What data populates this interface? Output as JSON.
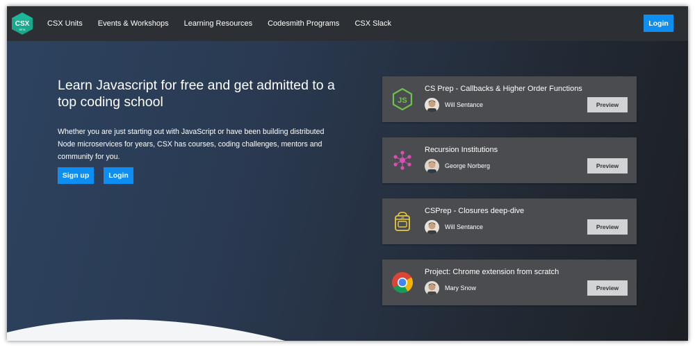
{
  "brand": {
    "logo_text": "CSX",
    "logo_subtext": "BETA",
    "accent": "#0d8ef0"
  },
  "nav": {
    "links": [
      "CSX Units",
      "Events & Workshops",
      "Learning Resources",
      "Codesmith Programs",
      "CSX Slack"
    ],
    "login_label": "Login"
  },
  "hero": {
    "title": "Learn Javascript for free and get admitted to a top coding school",
    "description": "Whether you are just starting out with JavaScript or have been building distributed Node microservices for years, CSX has courses, coding challenges, mentors and community for you.",
    "signup_label": "Sign up",
    "login_label": "Login"
  },
  "courses": [
    {
      "title": "CS Prep - Callbacks & Higher Order Functions",
      "author": "Will Sentance",
      "icon": "nodejs-icon",
      "preview_label": "Preview"
    },
    {
      "title": "Recursion Institutions",
      "author": "George Norberg",
      "icon": "recursion-icon",
      "preview_label": "Preview"
    },
    {
      "title": "CSPrep - Closures deep-dive",
      "author": "Will Sentance",
      "icon": "backpack-icon",
      "preview_label": "Preview"
    },
    {
      "title": "Project: Chrome extension from scratch",
      "author": "Mary Snow",
      "icon": "chrome-icon",
      "preview_label": "Preview"
    }
  ]
}
